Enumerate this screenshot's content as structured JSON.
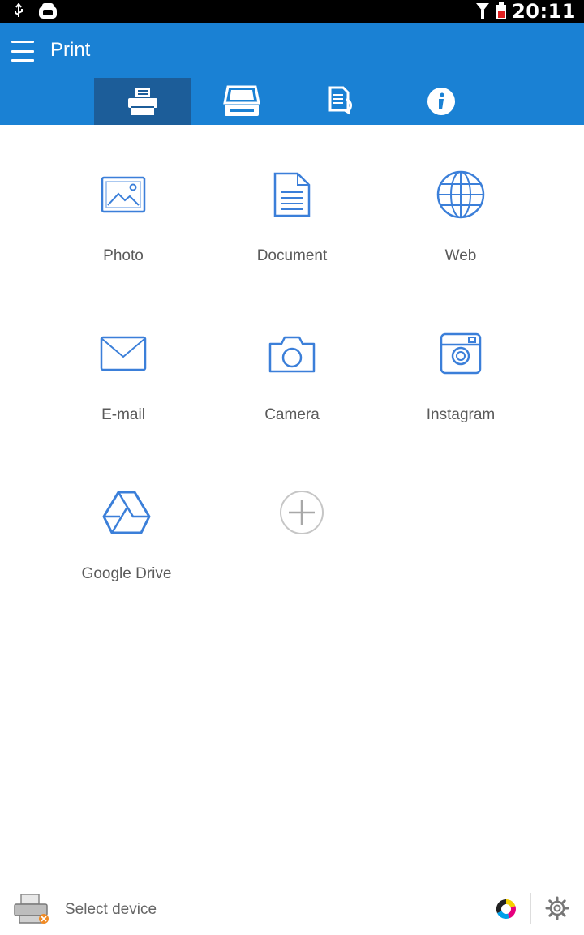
{
  "status_bar": {
    "time": "20:11"
  },
  "app_bar": {
    "title": "Print"
  },
  "tabs": [
    {
      "name": "print",
      "icon": "printer-icon",
      "active": true
    },
    {
      "name": "scan",
      "icon": "scanner-icon",
      "active": false
    },
    {
      "name": "copy",
      "icon": "copy-icon",
      "active": false
    },
    {
      "name": "info",
      "icon": "info-icon",
      "active": false
    }
  ],
  "grid": {
    "items": [
      {
        "label": "Photo",
        "icon": "photo-icon"
      },
      {
        "label": "Document",
        "icon": "document-icon"
      },
      {
        "label": "Web",
        "icon": "globe-icon"
      },
      {
        "label": "E-mail",
        "icon": "envelope-icon"
      },
      {
        "label": "Camera",
        "icon": "camera-icon"
      },
      {
        "label": "Instagram",
        "icon": "instagram-icon"
      },
      {
        "label": "Google Drive",
        "icon": "google-drive-icon"
      },
      {
        "label": "",
        "icon": "add-icon"
      }
    ]
  },
  "bottom_bar": {
    "device_label": "Select device"
  },
  "colors": {
    "accent": "#1a81d4",
    "active_tab": "#1c5d99",
    "icon_blue": "#3b7fd9",
    "label_gray": "#5a5a5a"
  }
}
